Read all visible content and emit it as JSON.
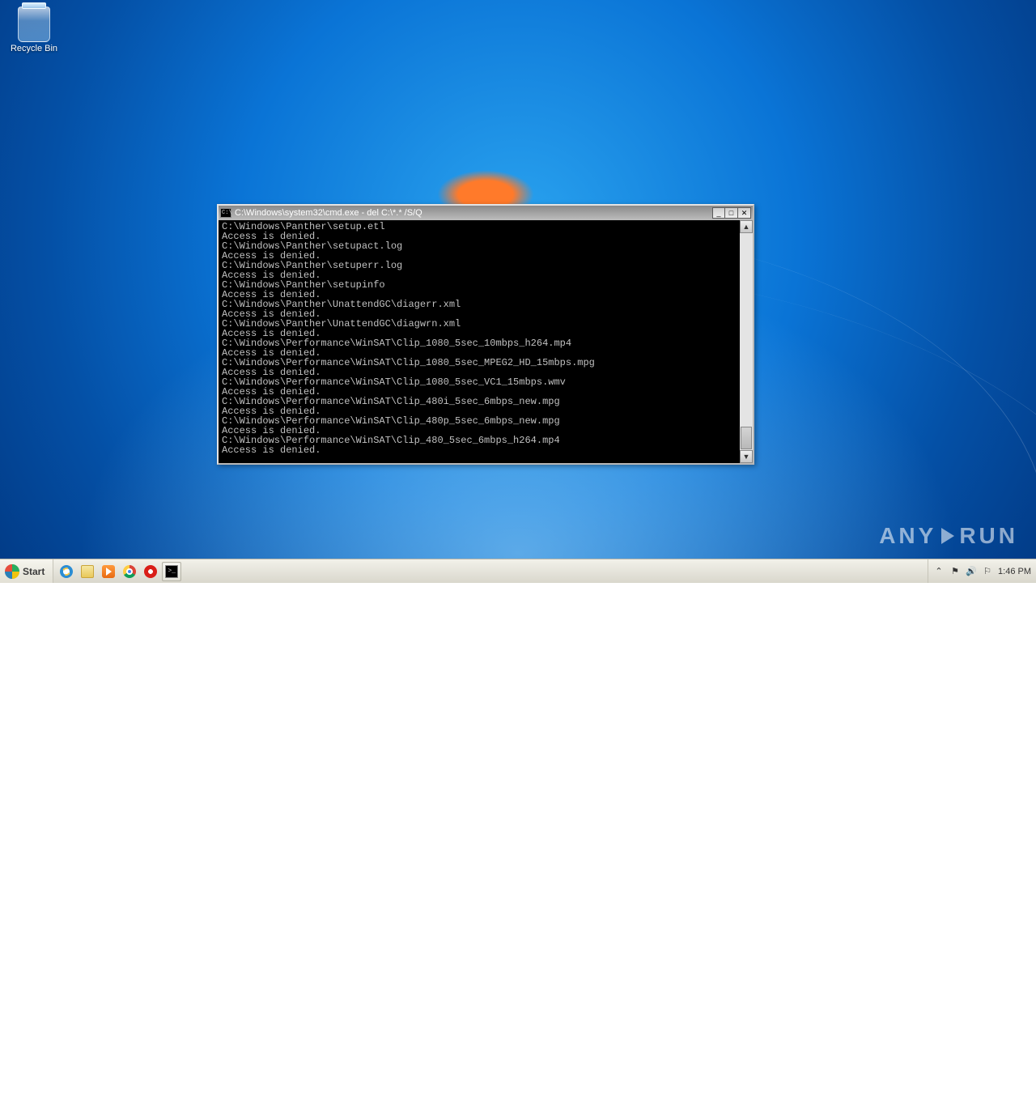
{
  "desktop": {
    "icons": [
      {
        "name": "recycle-bin",
        "label": "Recycle Bin"
      }
    ]
  },
  "cmd": {
    "title": "C:\\Windows\\system32\\cmd.exe - del  C:\\*.* /S/Q",
    "title_buttons": {
      "minimize": "_",
      "maximize": "□",
      "close": "✕"
    },
    "scrollbar": {
      "up": "▲",
      "down": "▼"
    },
    "lines": [
      "C:\\Windows\\Panther\\setup.etl",
      "Access is denied.",
      "C:\\Windows\\Panther\\setupact.log",
      "Access is denied.",
      "C:\\Windows\\Panther\\setuperr.log",
      "Access is denied.",
      "C:\\Windows\\Panther\\setupinfo",
      "Access is denied.",
      "C:\\Windows\\Panther\\UnattendGC\\diagerr.xml",
      "Access is denied.",
      "C:\\Windows\\Panther\\UnattendGC\\diagwrn.xml",
      "Access is denied.",
      "C:\\Windows\\Performance\\WinSAT\\Clip_1080_5sec_10mbps_h264.mp4",
      "Access is denied.",
      "C:\\Windows\\Performance\\WinSAT\\Clip_1080_5sec_MPEG2_HD_15mbps.mpg",
      "Access is denied.",
      "C:\\Windows\\Performance\\WinSAT\\Clip_1080_5sec_VC1_15mbps.wmv",
      "Access is denied.",
      "C:\\Windows\\Performance\\WinSAT\\Clip_480i_5sec_6mbps_new.mpg",
      "Access is denied.",
      "C:\\Windows\\Performance\\WinSAT\\Clip_480p_5sec_6mbps_new.mpg",
      "Access is denied.",
      "C:\\Windows\\Performance\\WinSAT\\Clip_480_5sec_6mbps_h264.mp4",
      "Access is denied."
    ]
  },
  "watermark": {
    "left": "ANY",
    "right": "RUN"
  },
  "taskbar": {
    "start_label": "Start",
    "quicklaunch": [
      {
        "name": "internet-explorer",
        "active": false
      },
      {
        "name": "file-explorer",
        "active": false
      },
      {
        "name": "media-player",
        "active": false
      },
      {
        "name": "google-chrome",
        "active": false
      },
      {
        "name": "opera",
        "active": false
      },
      {
        "name": "cmd",
        "active": true
      }
    ],
    "tray": {
      "show_hidden": "⌃",
      "action_center": "⚑",
      "volume": "🔊",
      "flag": "⚐",
      "clock": "1:46 PM"
    }
  }
}
